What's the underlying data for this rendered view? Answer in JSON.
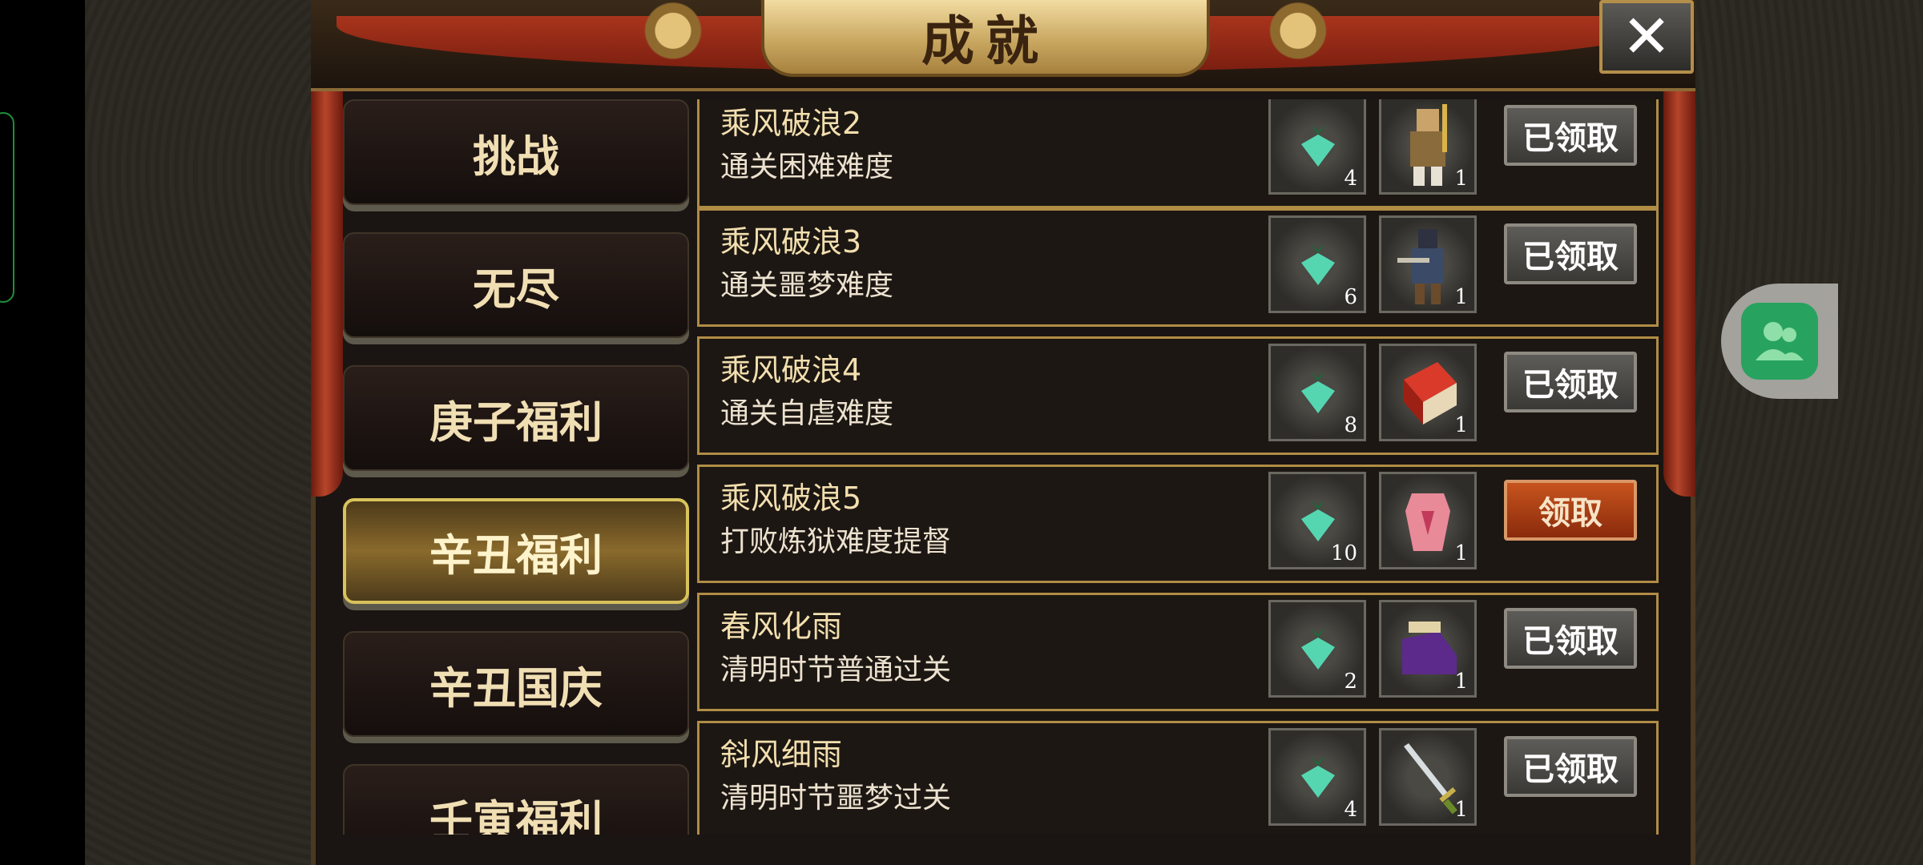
{
  "window": {
    "title": "成就",
    "close_label": "✕"
  },
  "menu": {
    "items": [
      {
        "label": "挑战",
        "active": false
      },
      {
        "label": "无尽",
        "active": false
      },
      {
        "label": "庚子福利",
        "active": false
      },
      {
        "label": "辛丑福利",
        "active": true
      },
      {
        "label": "辛丑国庆",
        "active": false
      },
      {
        "label": "壬寅福利",
        "active": false
      }
    ]
  },
  "achievements": [
    {
      "title": "乘风破浪2",
      "desc": "通关困难难度",
      "reward1": "4",
      "reward2": "1",
      "reward2_icon": "warrior-icon",
      "button": "已领取",
      "claimable": false
    },
    {
      "title": "乘风破浪3",
      "desc": "通关噩梦难度",
      "reward1": "6",
      "reward2": "1",
      "reward2_icon": "archer-icon",
      "button": "已领取",
      "claimable": false
    },
    {
      "title": "乘风破浪4",
      "desc": "通关自虐难度",
      "reward1": "8",
      "reward2": "1",
      "reward2_icon": "red-book-icon",
      "button": "已领取",
      "claimable": false
    },
    {
      "title": "乘风破浪5",
      "desc": "打败炼狱难度提督",
      "reward1": "10",
      "reward2": "1",
      "reward2_icon": "pink-armor-icon",
      "button": "领取",
      "claimable": true
    },
    {
      "title": "春风化雨",
      "desc": "清明时节普通过关",
      "reward1": "2",
      "reward2": "1",
      "reward2_icon": "purple-boots-icon",
      "button": "已领取",
      "claimable": false
    },
    {
      "title": "斜风细雨",
      "desc": "清明时节噩梦过关",
      "reward1": "4",
      "reward2": "1",
      "reward2_icon": "sword-icon",
      "button": "已领取",
      "claimable": false
    }
  ],
  "colors": {
    "gold": "#d8c25b",
    "claim": "#b5461a",
    "frame": "#b08c45"
  }
}
